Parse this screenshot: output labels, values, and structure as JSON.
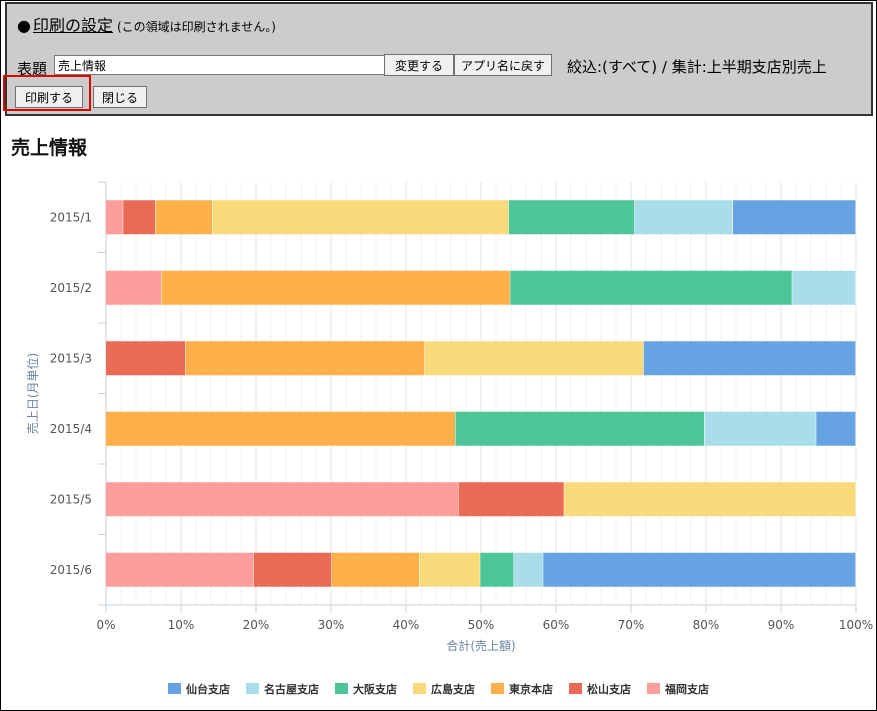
{
  "print_panel": {
    "dot": "●",
    "title": "印刷の設定",
    "note": "(この領域は印刷されません。)",
    "title_label": "表題",
    "title_value": "売上情報",
    "change_button": "変更する",
    "reset_button": "アプリ名に戻す",
    "filter_text": "絞込:(すべて) / 集計:上半期支店別売上",
    "print_button": "印刷する",
    "close_button": "閉じる"
  },
  "chart_data": {
    "type": "bar",
    "orientation": "horizontal",
    "stacked": "percent",
    "title": "売上情報",
    "xlabel": "合計(売上額)",
    "ylabel": "売上日(月単位)",
    "xlim": [
      0,
      100
    ],
    "x_ticks": [
      "0%",
      "10%",
      "20%",
      "30%",
      "40%",
      "50%",
      "60%",
      "70%",
      "80%",
      "90%",
      "100%"
    ],
    "categories": [
      "2015/1",
      "2015/2",
      "2015/3",
      "2015/4",
      "2015/5",
      "2015/6"
    ],
    "grid": true,
    "legend_position": "bottom",
    "series": [
      {
        "name": "福岡支店",
        "color": "#fc9e9b",
        "values": [
          2.3,
          7.4,
          0,
          0,
          47.0,
          19.7
        ]
      },
      {
        "name": "松山支店",
        "color": "#e96a55",
        "values": [
          4.3,
          0,
          10.6,
          0,
          14.1,
          10.4
        ]
      },
      {
        "name": "東京本店",
        "color": "#fdaf4a",
        "values": [
          7.6,
          46.5,
          31.9,
          46.6,
          0,
          11.7
        ]
      },
      {
        "name": "広島支店",
        "color": "#f9da7b",
        "values": [
          39.5,
          0,
          29.2,
          0,
          38.9,
          8.1
        ]
      },
      {
        "name": "大阪支店",
        "color": "#4cc597",
        "values": [
          16.8,
          37.6,
          0,
          33.2,
          0,
          4.5
        ]
      },
      {
        "name": "名古屋支店",
        "color": "#a8dde9",
        "values": [
          13.1,
          8.5,
          0,
          14.9,
          0,
          3.9
        ]
      },
      {
        "name": "仙台支店",
        "color": "#67a3e2",
        "values": [
          16.4,
          0,
          28.3,
          5.3,
          0,
          41.7
        ]
      }
    ],
    "legend_order": [
      "仙台支店",
      "名古屋支店",
      "大阪支店",
      "広島支店",
      "東京本店",
      "松山支店",
      "福岡支店"
    ]
  }
}
